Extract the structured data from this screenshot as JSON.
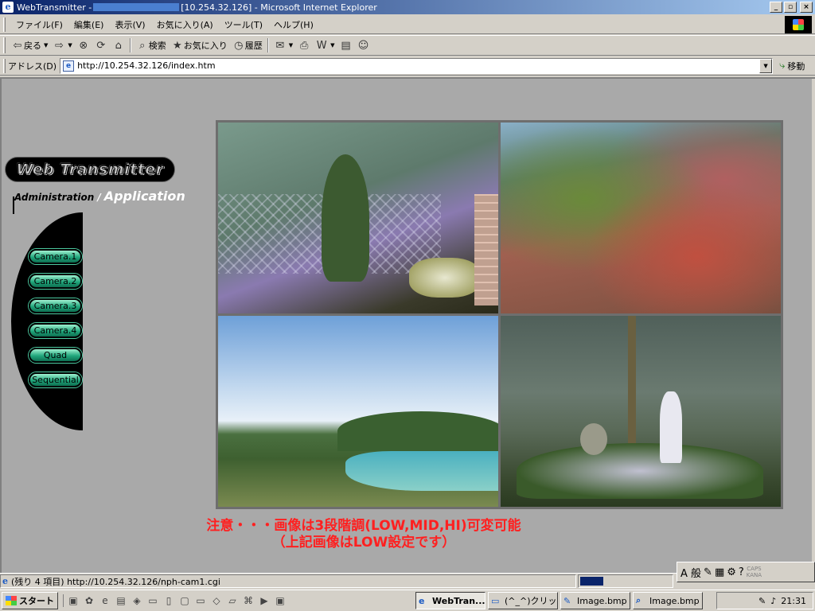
{
  "window": {
    "title_prefix": "WebTransmitter -",
    "title_suffix": "[10.254.32.126] - Microsoft Internet Explorer",
    "minimize": "_",
    "maximize": "▫",
    "close": "×"
  },
  "menu": {
    "items": [
      "ファイル(F)",
      "編集(E)",
      "表示(V)",
      "お気に入り(A)",
      "ツール(T)",
      "ヘルプ(H)"
    ]
  },
  "toolbar": {
    "back": "戻る",
    "search": "検索",
    "favorites": "お気に入り",
    "history": "履歴"
  },
  "address": {
    "label": "アドレス(D)",
    "url": "http://10.254.32.126/index.htm",
    "go": "移動"
  },
  "page": {
    "logo": "Web Transmitter",
    "admin": "Administration",
    "slash": "/",
    "application": "Application",
    "nav": [
      "Camera.1",
      "Camera.2",
      "Camera.3",
      "Camera.4",
      "Quad",
      "Sequential"
    ],
    "notice_line1": "注意・・・画像は3段階調(LOW,MID,HI)可変可能",
    "notice_line2": "（上記画像はLOW設定です）"
  },
  "status": {
    "text": "(残り 4 項目) http://10.254.32.126/nph-cam1.cgi",
    "progress": 0.25,
    "ime": "A 般"
  },
  "taskbar": {
    "start": "スタート",
    "tasks": [
      "WebTran...",
      "(^_^)クリッ...",
      "Image.bmp ...",
      "Image.bmp ..."
    ],
    "clock": "21:31"
  },
  "colors": {
    "title_gradient_start": "#0a246a",
    "notice": "#ff2020",
    "nav_button": "#21a77c",
    "page_background": "#a9a9a9"
  }
}
